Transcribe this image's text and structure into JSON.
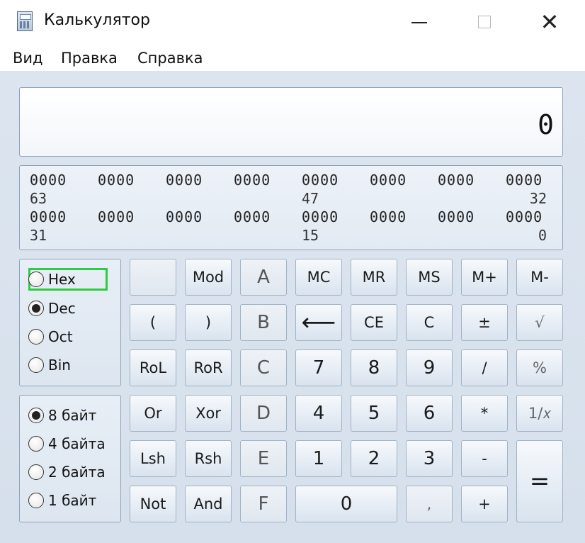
{
  "window": {
    "title": "Калькулятор",
    "minimize_icon": "minimize-icon",
    "maximize_icon": "maximize-icon",
    "close_icon": "close-icon",
    "close_glyph": "✕"
  },
  "menu": [
    "Вид",
    "Правка",
    "Справка"
  ],
  "display": {
    "value": "0"
  },
  "bits": {
    "row1": [
      "0000",
      "0000",
      "0000",
      "0000",
      "0000",
      "0000",
      "0000",
      "0000"
    ],
    "row1_labels": [
      "63",
      "47",
      "32"
    ],
    "row2": [
      "0000",
      "0000",
      "0000",
      "0000",
      "0000",
      "0000",
      "0000",
      "0000"
    ],
    "row2_labels": [
      "31",
      "15",
      "0"
    ]
  },
  "number_base": {
    "options": [
      "Hex",
      "Dec",
      "Oct",
      "Bin"
    ],
    "selected": "Dec",
    "focused": "Hex"
  },
  "word_size": {
    "options": [
      "8 байт",
      "4 байта",
      "2 байта",
      "1 байт"
    ],
    "selected": "8 байт"
  },
  "buttons": {
    "blank": "",
    "mod": "Mod",
    "a": "A",
    "mc": "MC",
    "mr": "MR",
    "ms": "MS",
    "mplus": "M+",
    "mminus": "M-",
    "lparen": "(",
    "rparen": ")",
    "b": "B",
    "back": "⟵",
    "ce": "CE",
    "c": "C",
    "plusminus": "±",
    "sqrt": "√",
    "rol": "RoL",
    "ror": "RoR",
    "hc": "C",
    "n7": "7",
    "n8": "8",
    "n9": "9",
    "div": "/",
    "pct": "%",
    "or": "Or",
    "xor": "Xor",
    "d": "D",
    "n4": "4",
    "n5": "5",
    "n6": "6",
    "mul": "*",
    "recip": "1/𝑥",
    "lsh": "Lsh",
    "rsh": "Rsh",
    "e": "E",
    "n1": "1",
    "n2": "2",
    "n3": "3",
    "sub": "-",
    "eq": "=",
    "not": "Not",
    "and": "And",
    "f": "F",
    "n0": "0",
    "dot": ",",
    "add": "+"
  }
}
